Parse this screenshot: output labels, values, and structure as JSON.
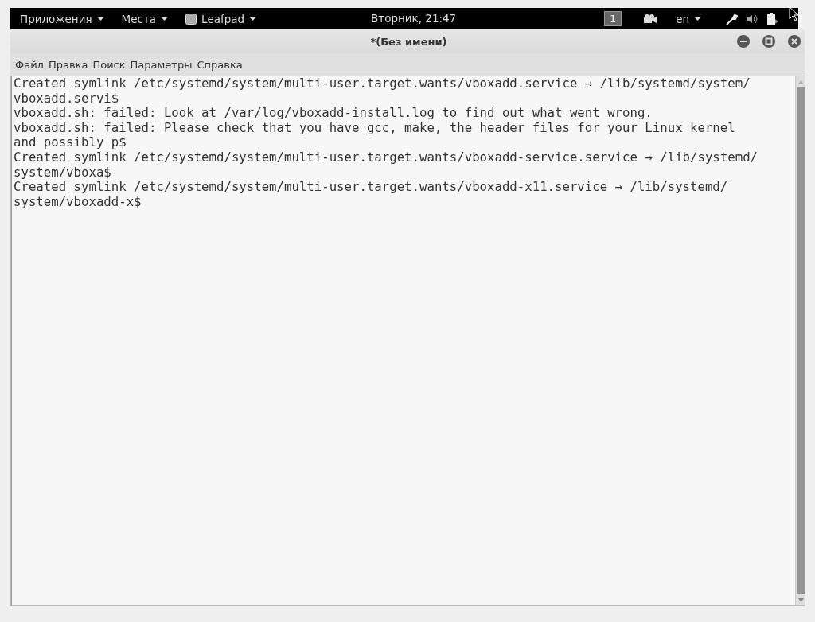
{
  "top_panel": {
    "menus": [
      {
        "label": "Приложения",
        "kind": "menu"
      },
      {
        "label": "Места",
        "kind": "menu"
      },
      {
        "label": "Leafpad",
        "kind": "app"
      }
    ],
    "clock": "Вторник, 21:47",
    "workspace": "1",
    "keyboard_layout": "en"
  },
  "window": {
    "title": "*(Без имени)",
    "menu": [
      "Файл",
      "Правка",
      "Поиск",
      "Параметры",
      "Справка"
    ],
    "text_lines": [
      "Created symlink /etc/systemd/system/multi-user.target.wants/vboxadd.service → /lib/systemd/system/",
      "vboxadd.servi$",
      "vboxadd.sh: failed: Look at /var/log/vboxadd-install.log to find out what went wrong.",
      "vboxadd.sh: failed: Please check that you have gcc, make, the header files for your Linux kernel",
      "and possibly p$",
      "Created symlink /etc/systemd/system/multi-user.target.wants/vboxadd-service.service → /lib/systemd/",
      "system/vboxa$",
      "Created symlink /etc/systemd/system/multi-user.target.wants/vboxadd-x11.service → /lib/systemd/",
      "system/vboxadd-x$"
    ]
  }
}
